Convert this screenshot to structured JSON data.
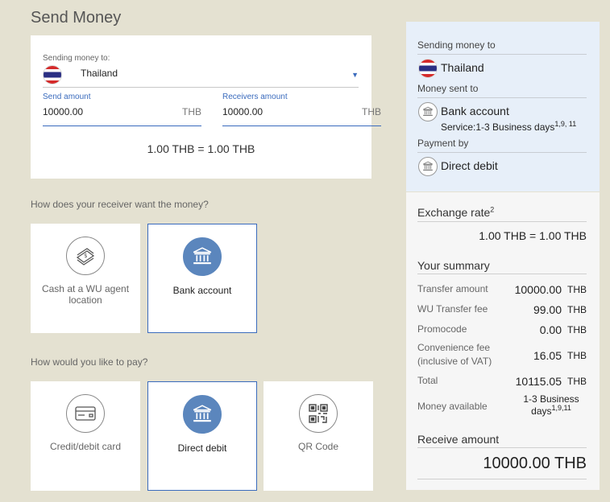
{
  "page_title": "Send Money",
  "form": {
    "country_label": "Sending money to:",
    "country": "Thailand",
    "send_label": "Send amount",
    "send_value": "10000.00",
    "send_currency": "THB",
    "receive_label": "Receivers amount",
    "receive_value": "10000.00",
    "receive_currency": "THB",
    "rate": "1.00 THB = 1.00 THB"
  },
  "receive_question": "How does your receiver want the money?",
  "receive_options": [
    {
      "label": "Cash at a WU agent location",
      "icon": "cash-icon",
      "selected": false
    },
    {
      "label": "Bank account",
      "icon": "bank-icon",
      "selected": true
    }
  ],
  "pay_question": "How would you like to pay?",
  "pay_options": [
    {
      "label": "Credit/debit card",
      "icon": "credit-card-icon",
      "selected": false
    },
    {
      "label": "Direct debit",
      "icon": "bank-icon",
      "selected": true
    },
    {
      "label": "QR Code",
      "icon": "qr-code-icon",
      "selected": false
    }
  ],
  "summary": {
    "sending_to_heading": "Sending money to",
    "sending_to_country": "Thailand",
    "money_sent_to_heading": "Money sent to",
    "money_sent_to": "Bank account",
    "service": "Service:1-3 Business days",
    "service_sup": "1,9, 11",
    "payment_heading": "Payment by",
    "payment": "Direct debit",
    "exchange_heading": "Exchange rate",
    "exchange_sup": "2",
    "exchange_value": "1.00 THB = 1.00 THB",
    "your_summary": "Your summary",
    "rows": [
      {
        "label": "Transfer amount",
        "value": "10000.00",
        "unit": "THB"
      },
      {
        "label": "WU Transfer fee",
        "value": "99.00",
        "unit": "THB"
      },
      {
        "label": "Promocode",
        "value": "0.00",
        "unit": "THB"
      },
      {
        "label": "Convenience fee (inclusive of VAT)",
        "value": "16.05",
        "unit": "THB"
      },
      {
        "label": "Total",
        "value": "10115.05",
        "unit": "THB"
      }
    ],
    "money_available_label": "Money available",
    "money_available_line1": "1-3 Business",
    "money_available_line2": "days",
    "money_available_sup": "1,9,11",
    "receive_heading": "Receive amount",
    "receive_value": "10000.00 THB"
  },
  "colors": {
    "background": "#e4e1d1",
    "accent": "#3a6bbd",
    "selected_icon": "#5b86bd",
    "summary_top": "#e7eff9",
    "summary_bottom": "#f6f6f6"
  }
}
